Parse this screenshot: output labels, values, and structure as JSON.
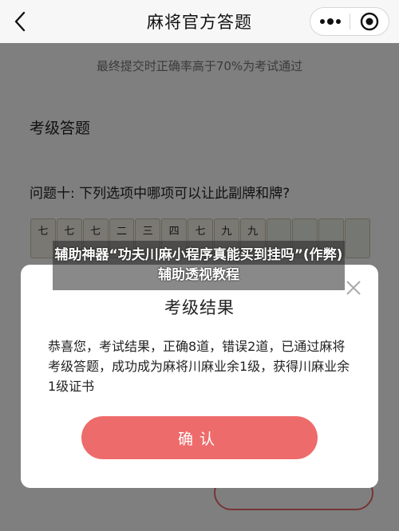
{
  "nav": {
    "title": "麻将官方答题",
    "icons": [
      "chevron-left-icon",
      "more-dots-icon",
      "target-circle-icon"
    ]
  },
  "page": {
    "notice": "最终提交时正确率高于70%为考试通过",
    "section_title": "考级答题",
    "question": "问题十: 下列选项中哪项可以让此副牌和牌?",
    "tiles": [
      "七",
      "七",
      "七",
      "二",
      "三",
      "四",
      "七",
      "九",
      "九",
      "",
      "",
      "",
      ""
    ]
  },
  "modal": {
    "title": "考级结果",
    "body": "恭喜您，考试结果，正确8道，错误2道，已通过麻将考级答题，成功成为麻将川麻业余1级，获得川麻业余1级证书",
    "confirm_label": "确认",
    "close_icon": "close-icon"
  },
  "caption": {
    "text": "辅助神器“功夫川麻小程序真能买到挂吗”(作弊)辅助透视教程"
  },
  "colors": {
    "accent": "#ee6b6b",
    "overlay": "rgba(0,0,0,0.5)",
    "nav_bg": "#f7f7f7"
  }
}
